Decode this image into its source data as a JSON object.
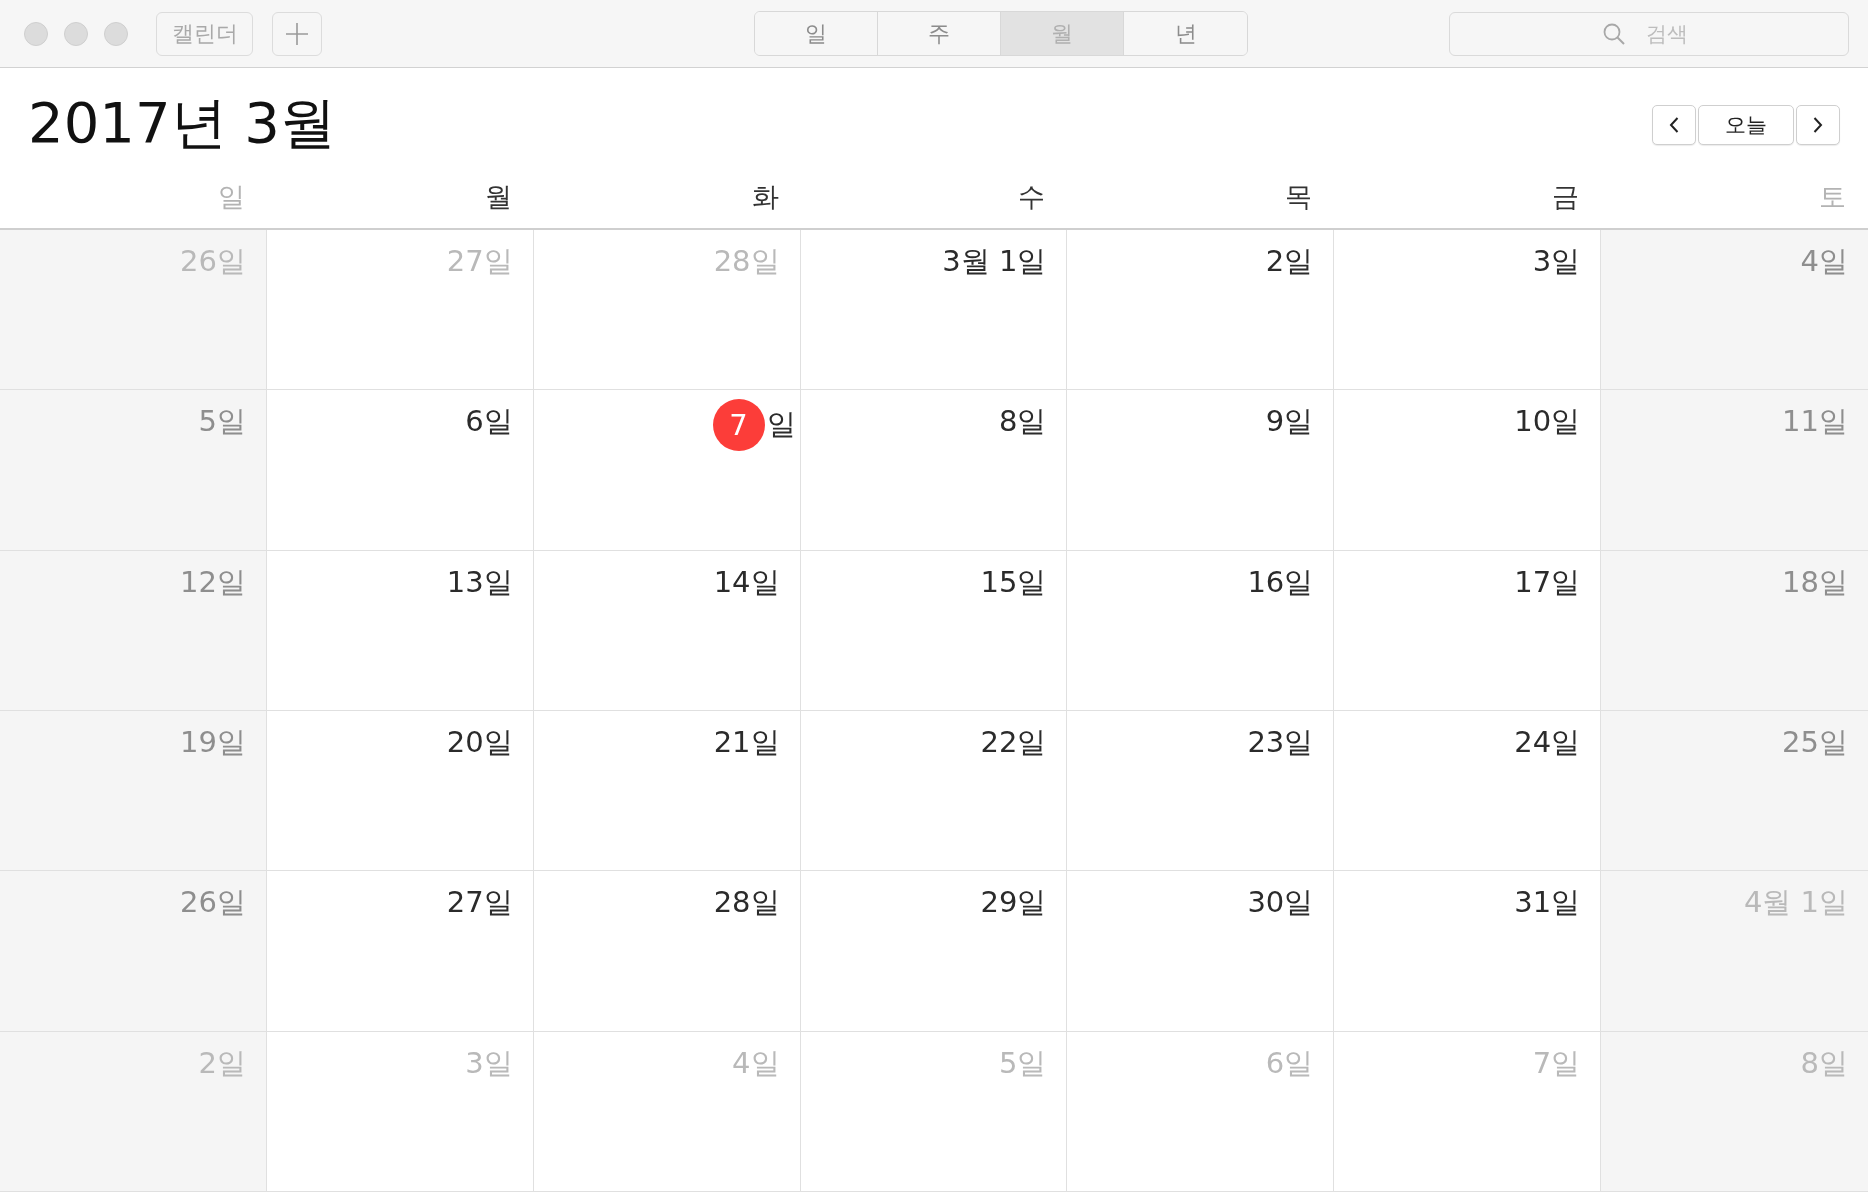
{
  "toolbar": {
    "calendars_button": "캘린더",
    "view_tabs": [
      {
        "label": "일",
        "selected": false
      },
      {
        "label": "주",
        "selected": false
      },
      {
        "label": "월",
        "selected": true
      },
      {
        "label": "년",
        "selected": false
      }
    ],
    "search": {
      "placeholder": "검색"
    }
  },
  "header": {
    "title": "2017년 3월",
    "today_button": "오늘"
  },
  "weekdays": [
    {
      "label": "일",
      "weekend": true
    },
    {
      "label": "월",
      "weekend": false
    },
    {
      "label": "화",
      "weekend": false
    },
    {
      "label": "수",
      "weekend": false
    },
    {
      "label": "목",
      "weekend": false
    },
    {
      "label": "금",
      "weekend": false
    },
    {
      "label": "토",
      "weekend": true
    }
  ],
  "weeks": [
    {
      "days": [
        {
          "label": "26일",
          "in_month": false,
          "today": false
        },
        {
          "label": "27일",
          "in_month": false,
          "today": false
        },
        {
          "label": "28일",
          "in_month": false,
          "today": false
        },
        {
          "label": "3월 1일",
          "in_month": true,
          "today": false
        },
        {
          "label": "2일",
          "in_month": true,
          "today": false
        },
        {
          "label": "3일",
          "in_month": true,
          "today": false
        },
        {
          "label": "4일",
          "in_month": true,
          "today": false
        }
      ]
    },
    {
      "days": [
        {
          "label": "5일",
          "in_month": true,
          "today": false
        },
        {
          "label": "6일",
          "in_month": true,
          "today": false
        },
        {
          "badge": "7",
          "label": "일",
          "in_month": true,
          "today": true
        },
        {
          "label": "8일",
          "in_month": true,
          "today": false
        },
        {
          "label": "9일",
          "in_month": true,
          "today": false
        },
        {
          "label": "10일",
          "in_month": true,
          "today": false
        },
        {
          "label": "11일",
          "in_month": true,
          "today": false
        }
      ]
    },
    {
      "days": [
        {
          "label": "12일",
          "in_month": true,
          "today": false
        },
        {
          "label": "13일",
          "in_month": true,
          "today": false
        },
        {
          "label": "14일",
          "in_month": true,
          "today": false
        },
        {
          "label": "15일",
          "in_month": true,
          "today": false
        },
        {
          "label": "16일",
          "in_month": true,
          "today": false
        },
        {
          "label": "17일",
          "in_month": true,
          "today": false
        },
        {
          "label": "18일",
          "in_month": true,
          "today": false
        }
      ]
    },
    {
      "days": [
        {
          "label": "19일",
          "in_month": true,
          "today": false
        },
        {
          "label": "20일",
          "in_month": true,
          "today": false
        },
        {
          "label": "21일",
          "in_month": true,
          "today": false
        },
        {
          "label": "22일",
          "in_month": true,
          "today": false
        },
        {
          "label": "23일",
          "in_month": true,
          "today": false
        },
        {
          "label": "24일",
          "in_month": true,
          "today": false
        },
        {
          "label": "25일",
          "in_month": true,
          "today": false
        }
      ]
    },
    {
      "days": [
        {
          "label": "26일",
          "in_month": true,
          "today": false
        },
        {
          "label": "27일",
          "in_month": true,
          "today": false
        },
        {
          "label": "28일",
          "in_month": true,
          "today": false
        },
        {
          "label": "29일",
          "in_month": true,
          "today": false
        },
        {
          "label": "30일",
          "in_month": true,
          "today": false
        },
        {
          "label": "31일",
          "in_month": true,
          "today": false
        },
        {
          "label": "4월 1일",
          "in_month": false,
          "today": false
        }
      ]
    },
    {
      "days": [
        {
          "label": "2일",
          "in_month": false,
          "today": false
        },
        {
          "label": "3일",
          "in_month": false,
          "today": false
        },
        {
          "label": "4일",
          "in_month": false,
          "today": false
        },
        {
          "label": "5일",
          "in_month": false,
          "today": false
        },
        {
          "label": "6일",
          "in_month": false,
          "today": false
        },
        {
          "label": "7일",
          "in_month": false,
          "today": false
        },
        {
          "label": "8일",
          "in_month": false,
          "today": false
        }
      ]
    }
  ]
}
